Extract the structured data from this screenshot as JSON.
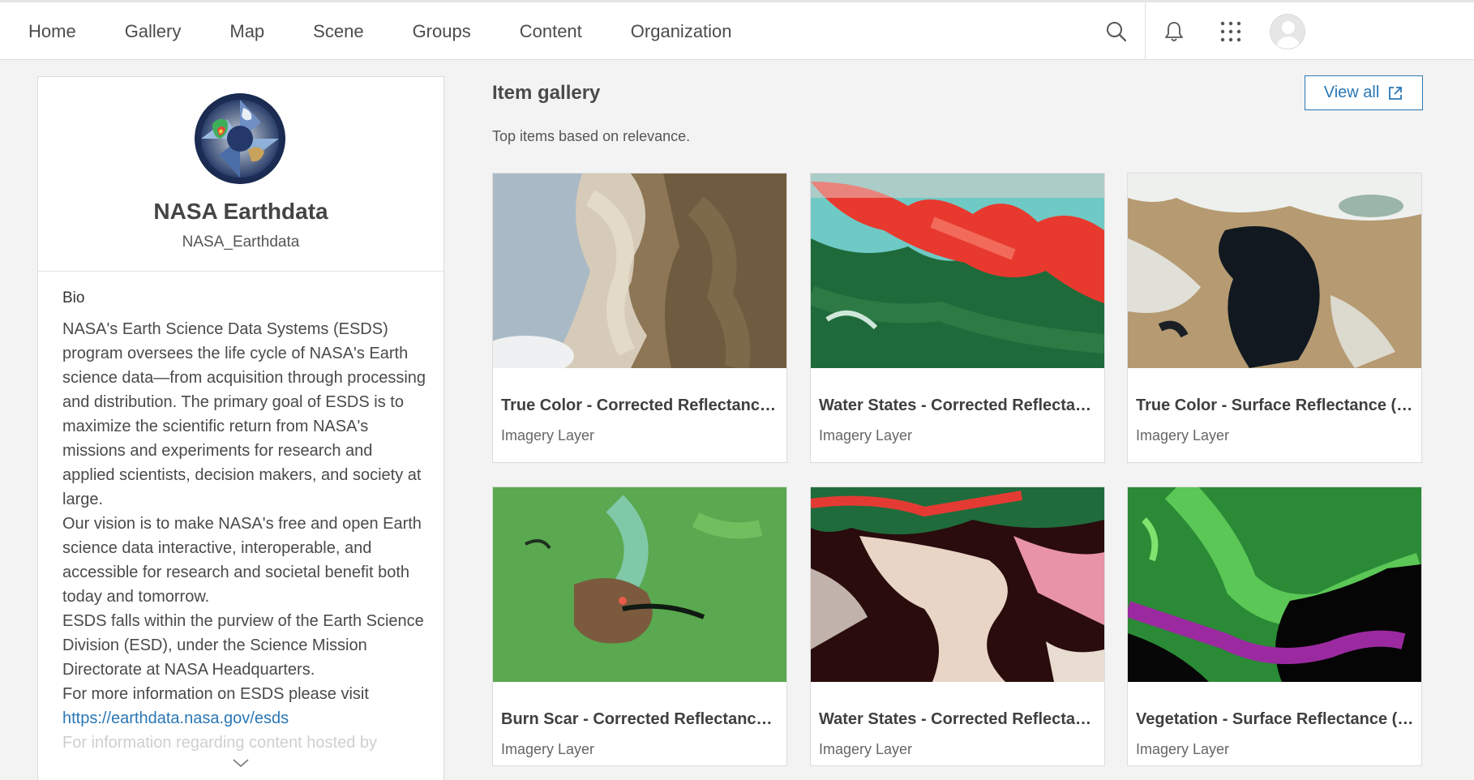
{
  "nav": {
    "items": [
      "Home",
      "Gallery",
      "Map",
      "Scene",
      "Groups",
      "Content",
      "Organization"
    ]
  },
  "top_icons": [
    "search-icon",
    "bell-icon",
    "app-launcher-icon",
    "user-avatar"
  ],
  "profile": {
    "name": "NASA Earthdata",
    "username": "NASA_Earthdata",
    "bio_title": "Bio",
    "bio_paragraphs": [
      "NASA's Earth Science Data Systems (ESDS) program oversees the life cycle of NASA's Earth science data—from acquisition through processing and distribution. The primary goal of ESDS is to maximize the scientific return from NASA's missions and experiments for research and applied scientists, decision makers, and society at large.",
      "Our vision is to make NASA's free and open Earth science data interactive, interoperable, and accessible for research and societal benefit both today and tomorrow.",
      "ESDS falls within the purview of the Earth Science Division (ESD), under the Science Mission Directorate at NASA Headquarters.",
      "For more information on ESDS please visit"
    ],
    "bio_link": "https://earthdata.nasa.gov/esds",
    "bio_cutoff": "For information regarding content hosted by"
  },
  "gallery": {
    "title": "Item gallery",
    "subtitle": "Top items based on relevance.",
    "view_all_label": "View all",
    "items": [
      {
        "title": "True Color - Corrected Reflectance (MODIS, Terra)",
        "type": "Imagery Layer"
      },
      {
        "title": "Water States - Corrected Reflectance (MODIS, Terra)",
        "type": "Imagery Layer"
      },
      {
        "title": "True Color - Surface Reflectance (MODIS, Terra)",
        "type": "Imagery Layer"
      },
      {
        "title": "Burn Scar - Corrected Reflectance (MODIS, Terra)",
        "type": "Imagery Layer"
      },
      {
        "title": "Water States - Corrected Reflectance (MODIS, Aqua)",
        "type": "Imagery Layer"
      },
      {
        "title": "Vegetation - Surface Reflectance (MODIS, Terra)",
        "type": "Imagery Layer"
      }
    ]
  },
  "colors": {
    "accent": "#2a77b5",
    "page_bg": "#f3f3f3",
    "card_bg": "#ffffff"
  }
}
